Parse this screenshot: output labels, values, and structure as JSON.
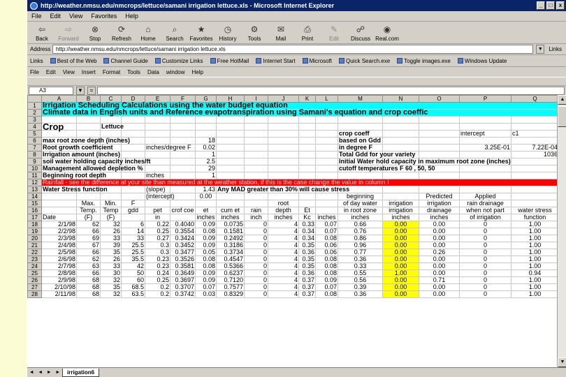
{
  "window": {
    "title": "http://weather.nmsu.edu/nmcrops/lettuce/samani irrigation lettuce.xls - Microsoft Internet Explorer",
    "controls": [
      "_",
      "□",
      "x"
    ]
  },
  "ie_menu": [
    "File",
    "Edit",
    "View",
    "Favorites",
    "Help"
  ],
  "ie_toolbar": [
    {
      "label": "Back",
      "icon": "back-arrow-icon",
      "glyph": "⇦",
      "enabled": true
    },
    {
      "label": "Forward",
      "icon": "forward-arrow-icon",
      "glyph": "⇨",
      "enabled": false
    },
    {
      "label": "Stop",
      "icon": "stop-icon",
      "glyph": "⊗",
      "enabled": true
    },
    {
      "label": "Refresh",
      "icon": "refresh-icon",
      "glyph": "⟳",
      "enabled": true
    },
    {
      "label": "Home",
      "icon": "home-icon",
      "glyph": "⌂",
      "enabled": true
    },
    {
      "label": "Search",
      "icon": "search-icon",
      "glyph": "⌕",
      "enabled": true
    },
    {
      "label": "Favorites",
      "icon": "favorites-icon",
      "glyph": "★",
      "enabled": true
    },
    {
      "label": "History",
      "icon": "history-icon",
      "glyph": "◷",
      "enabled": true
    },
    {
      "label": "Tools",
      "icon": "tools-icon",
      "glyph": "⚙",
      "enabled": true
    },
    {
      "label": "Mail",
      "icon": "mail-icon",
      "glyph": "✉",
      "enabled": true
    },
    {
      "label": "Print",
      "icon": "print-icon",
      "glyph": "⎙",
      "enabled": true
    },
    {
      "label": "Edit",
      "icon": "edit-icon",
      "glyph": "✎",
      "enabled": false
    },
    {
      "label": "Discuss",
      "icon": "discuss-icon",
      "glyph": "☍",
      "enabled": true
    },
    {
      "label": "Real.com",
      "icon": "real-icon",
      "glyph": "◉",
      "enabled": true
    }
  ],
  "address": {
    "label": "Address",
    "value": "http://weather.nmsu.edu/nmcrops/lettuce/samani irrigation lettuce.xls",
    "go": "Links"
  },
  "links": [
    "Links",
    "Best of the Web",
    "Channel Guide",
    "Customize Links",
    "Free HotMail",
    "Internet Start",
    "Microsoft",
    "Quick Search.exe",
    "Toggle images.exe",
    "Windows Update"
  ],
  "excel_menu": [
    "File",
    "Edit",
    "View",
    "Insert",
    "Format",
    "Tools",
    "Data",
    "window",
    "Help"
  ],
  "formula_bar": {
    "name_box": "A3",
    "btn1": "▼",
    "btn2": "="
  },
  "columns": [
    "",
    "A",
    "B",
    "C",
    "D",
    "E",
    "F",
    "G",
    "H",
    "I",
    "J",
    "K",
    "L",
    "M",
    "N",
    "O",
    "P",
    "Q"
  ],
  "rows": {
    "r1": {
      "num": "1",
      "text": "Irrigation Scheduling Calculations using the water budget equation"
    },
    "r2": {
      "num": "2",
      "text": "Climate data in English units and Reference evapotranspiration using Samani's equation  and crop coeffic"
    },
    "r3": {
      "num": "3"
    },
    "r4": {
      "num": "4",
      "a": "Crop",
      "c": "Lettuce"
    },
    "r5": {
      "num": "5",
      "m": "crop coeff",
      "p": "intercept",
      "q": "c1"
    },
    "r6": {
      "num": "6",
      "a": "max root zone depth (inches)",
      "g": "18",
      "m": "based on Gdd"
    },
    "r7": {
      "num": "7",
      "a": "Root growth coefficient",
      "e": "inches/degree F",
      "g": "0.02",
      "m": "in degree F",
      "p": "3.25E-01",
      "q": "7.22E-04"
    },
    "r8": {
      "num": "8",
      "a": "Irrigation amount (inches)",
      "g": "1",
      "m": "Total Gdd for your variety",
      "q": "1036"
    },
    "r9": {
      "num": "9",
      "a": "soil water holding capacity inches/ft",
      "g": "2.5",
      "m": "Initial Water hold capacity in maximum root zone (inches)"
    },
    "r10": {
      "num": "10",
      "a": "Management allowed depletion %",
      "g": "29",
      "m": "cutoff temperatures F 60 , 50, 50"
    },
    "r11": {
      "num": "11",
      "a": "Beginning root depth",
      "e": "inches",
      "g": "1"
    },
    "r12": {
      "num": "12",
      "text": "Rainfall - see the difference at your site than measured at the weather station, if this is the case change the value in column I"
    },
    "r13": {
      "num": "13",
      "a": "Water Stress function",
      "e": "(slope)",
      "g": "1.43",
      "h": "Any MAD greater than 30% will cause stress"
    },
    "r14": {
      "num": "14",
      "e": "(intercept)",
      "g": "0.00",
      "m": "beginning",
      "o": "Predicted",
      "p": "Applied"
    },
    "r15": {
      "num": "15",
      "b": "Max.",
      "c": "Min.",
      "d": "F",
      "j": "root",
      "m": "of day water",
      "n": "irrigation",
      "o": "irrigation",
      "p": "rain drainage"
    },
    "r16": {
      "num": "16",
      "b": "Temp.",
      "c": "Temp",
      "d": "gdd",
      "e": "pet",
      "f": "crof coe",
      "g": "et",
      "h": "cum et",
      "i": "rain",
      "j": "depth",
      "k": "Et",
      "m": "in root zone",
      "n": "irrigation",
      "o": "drainage",
      "p": "when not part",
      "q": "water stress"
    },
    "r17": {
      "num": "17",
      "a": "Date",
      "b": "(F)",
      "c": "(F)",
      "e": "in",
      "g": "inches",
      "h": "inches",
      "i": "inch",
      "j": "inches",
      "k": "Kc",
      "l": "inches",
      "m": "inches",
      "n": "inches",
      "o": "inches",
      "p": "of irrigation",
      "q": "function"
    }
  },
  "data_rows": [
    {
      "num": "18",
      "date": "2/1/98",
      "tmax": "62",
      "tmin": "32",
      "gdd": "6",
      "pet": "0.22",
      "kc": "0.4040",
      "et": "0.09",
      "cum": "0.0735",
      "rain": "0",
      "depth": "4",
      "kcv": "0.33",
      "etl": "0.07",
      "wz": "0.66",
      "irr": "0.00",
      "drain": "0.00",
      "app": "0",
      "ws": "1.00"
    },
    {
      "num": "19",
      "date": "2/2/98",
      "tmax": "66",
      "tmin": "26",
      "gdd": "14",
      "pet": "0.25",
      "kc": "0.3554",
      "et": "0.08",
      "cum": "0.1581",
      "rain": "0",
      "depth": "4",
      "kcv": "0.34",
      "etl": "0.07",
      "wz": "0.76",
      "irr": "0.00",
      "drain": "0.00",
      "app": "0",
      "ws": "1.00"
    },
    {
      "num": "20",
      "date": "2/3/98",
      "tmax": "69",
      "tmin": "33",
      "gdd": "33",
      "pet": "0.27",
      "kc": "0.3424",
      "et": "0.09",
      "cum": "0.2492",
      "rain": "0",
      "depth": "4",
      "kcv": "0.34",
      "etl": "0.08",
      "wz": "0.86",
      "irr": "0.00",
      "drain": "0.00",
      "app": "0",
      "ws": "1.00"
    },
    {
      "num": "21",
      "date": "2/4/98",
      "tmax": "67",
      "tmin": "39",
      "gdd": "25.5",
      "pet": "0.3",
      "kc": "0.3452",
      "et": "0.09",
      "cum": "0.3186",
      "rain": "0",
      "depth": "4",
      "kcv": "0.35",
      "etl": "0.06",
      "wz": "0.96",
      "irr": "0.00",
      "drain": "0.00",
      "app": "0",
      "ws": "1.00"
    },
    {
      "num": "22",
      "date": "2/5/98",
      "tmax": "66",
      "tmin": "35",
      "gdd": "25.5",
      "pet": "0.3",
      "kc": "0.3477",
      "et": "0.05",
      "cum": "0.3734",
      "rain": "0",
      "depth": "4",
      "kcv": "0.36",
      "etl": "0.06",
      "wz": "0.77",
      "irr": "0.00",
      "drain": "0.26",
      "app": "0",
      "ws": "1.00"
    },
    {
      "num": "23",
      "date": "2/6/98",
      "tmax": "62",
      "tmin": "26",
      "gdd": "35.5",
      "pet": "0.23",
      "kc": "0.3526",
      "et": "0.08",
      "cum": "0.4547",
      "rain": "0",
      "depth": "4",
      "kcv": "0.35",
      "etl": "0.08",
      "wz": "0.36",
      "irr": "0.00",
      "drain": "0.00",
      "app": "0",
      "ws": "1.00"
    },
    {
      "num": "24",
      "date": "2/7/98",
      "tmax": "63",
      "tmin": "33",
      "gdd": "42",
      "pet": "0.23",
      "kc": "0.3581",
      "et": "0.08",
      "cum": "0.5366",
      "rain": "0",
      "depth": "4",
      "kcv": "0.35",
      "etl": "0.08",
      "wz": "0.33",
      "irr": "0.00",
      "drain": "0.00",
      "app": "0",
      "ws": "1.00"
    },
    {
      "num": "25",
      "date": "2/8/98",
      "tmax": "66",
      "tmin": "30",
      "gdd": "50",
      "pet": "0.24",
      "kc": "0.3649",
      "et": "0.09",
      "cum": "0.6237",
      "rain": "0",
      "depth": "4",
      "kcv": "0.36",
      "etl": "0.08",
      "wz": "0.55",
      "irr": "1.00",
      "drain": "0.00",
      "app": "0",
      "ws": "0.94"
    },
    {
      "num": "26",
      "date": "2/9/98",
      "tmax": "68",
      "tmin": "32",
      "gdd": "60",
      "pet": "0.25",
      "kc": "0.3697",
      "et": "0.09",
      "cum": "0.7120",
      "rain": "0",
      "depth": "4",
      "kcv": "0.37",
      "etl": "0.09",
      "wz": "0.56",
      "irr": "0.00",
      "drain": "0.71",
      "app": "0",
      "ws": "1.00"
    },
    {
      "num": "27",
      "date": "2/10/98",
      "tmax": "68",
      "tmin": "35",
      "gdd": "68.5",
      "pet": "0.2",
      "kc": "0.3707",
      "et": "0.07",
      "cum": "0.7577",
      "rain": "0",
      "depth": "4",
      "kcv": "0.37",
      "etl": "0.07",
      "wz": "0.39",
      "irr": "0.00",
      "drain": "0.00",
      "app": "0",
      "ws": "1.00"
    },
    {
      "num": "28",
      "date": "2/11/98",
      "tmax": "68",
      "tmin": "32",
      "gdd": "63.5",
      "pet": "0.2",
      "kc": "0.3742",
      "et": "0.03",
      "cum": "0.8329",
      "rain": "0",
      "depth": "4",
      "kcv": "0.37",
      "etl": "0.08",
      "wz": "0.36",
      "irr": "0.00",
      "drain": "0.00",
      "app": "0",
      "ws": "1.00"
    }
  ],
  "sheet_tab": "irrigation6",
  "colors": {
    "title_bar": "#0a246a",
    "title_band": "#00ffff",
    "alert_row": "#ff0000",
    "irrigation_col": "#ffff00",
    "slide_bg": "#fcfcd4"
  }
}
